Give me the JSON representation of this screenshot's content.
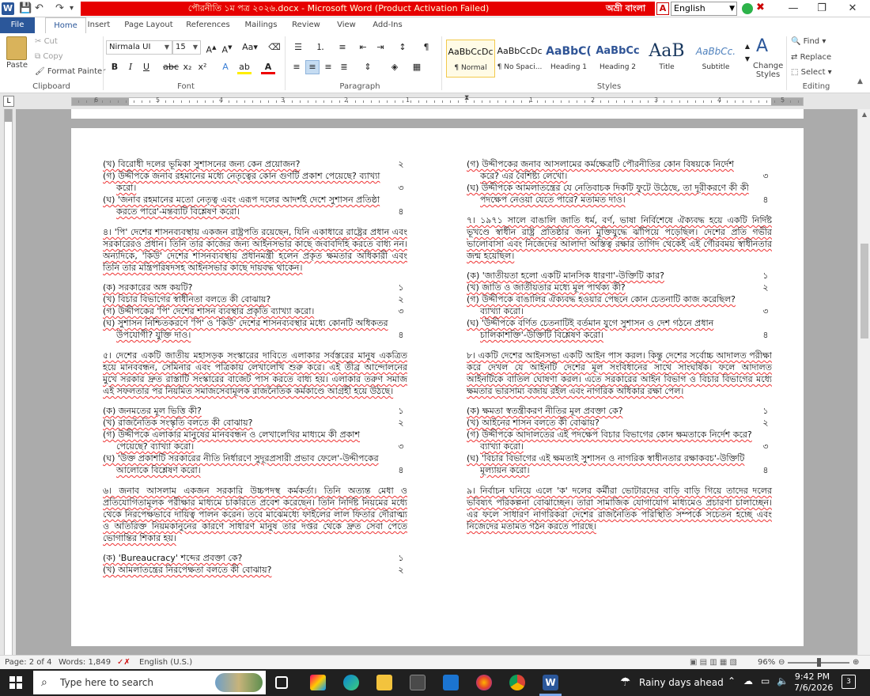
{
  "titlebar": {
    "document_title": "পৌরনীতি ১ম পত্র ২০২৬.docx - Microsoft Word (Product Activation Failed)",
    "ime_label": "অভ্রী বাংলা",
    "language_letter": "A",
    "language": "English",
    "window_buttons": [
      "—",
      "❐",
      "✕"
    ]
  },
  "tabs": [
    "File",
    "Home",
    "Insert",
    "Page Layout",
    "References",
    "Mailings",
    "Review",
    "View",
    "Add-Ins"
  ],
  "ribbon": {
    "clipboard": {
      "paste": "Paste",
      "cut": "Cut",
      "copy": "Copy",
      "format_painter": "Format Painter",
      "group": "Clipboard"
    },
    "font": {
      "name": "Nirmala UI",
      "size": "15",
      "group": "Font"
    },
    "paragraph": {
      "group": "Paragraph"
    },
    "styles": {
      "group": "Styles",
      "items": [
        {
          "sample": "AaBbCcDc",
          "label": "¶ Normal"
        },
        {
          "sample": "AaBbCcDc",
          "label": "¶ No Spaci..."
        },
        {
          "sample": "AaBbC(",
          "label": "Heading 1"
        },
        {
          "sample": "AaBbCc",
          "label": "Heading 2"
        },
        {
          "sample": "AaB",
          "label": "Title"
        },
        {
          "sample": "AaBbCc.",
          "label": "Subtitle"
        }
      ],
      "change_styles": "Change Styles"
    },
    "editing": {
      "find": "Find",
      "replace": "Replace",
      "select": "Select",
      "group": "Editing"
    }
  },
  "ruler": {
    "corner": "L",
    "numbers": [
      "6",
      "5",
      "4",
      "3",
      "2",
      "1",
      "1",
      "2",
      "3",
      "4",
      "5"
    ]
  },
  "document": {
    "left": [
      {
        "type": "questions",
        "items": [
          {
            "t": "(খ) বিরোধী দলের ভূমিকা সুশাসনের জন্য কেন প্রয়োজন?",
            "m": "২"
          },
          {
            "t": "(গ) উদ্দীপকে জনাব রহমানের মধ্যে নেতৃত্বের কোন গুণটি প্রকাশ পেয়েছে? ব্যাখ্যা করো।",
            "m": "৩"
          },
          {
            "t": "(ঘ) 'জনাব রহমানের মতো নেতৃত্ব এবং এরূপ দলের আদর্শই দেশে সুশাসন প্রতিষ্ঠা করতে পারে'-মন্তব্যটি বিশ্লেষণ করো।",
            "m": "৪"
          }
        ]
      },
      {
        "type": "para",
        "t": "৪। 'পি' দেশের শাসনব্যবস্থায় একজন রাষ্ট্রপতি রয়েছেন, যিনি একাধারে রাষ্ট্রের প্রধান এবং সরকারেরও প্রধান। তিনি তার কাজের জন্য আইনসভার কাছে জবাবদিহি করতে বাধ্য নন। অন্যদিকে, 'কিউ' দেশের শাসনব্যবস্থায় প্রধানমন্ত্রী হলেন প্রকৃত ক্ষমতার অধিকারী এবং তিনি তার মন্ত্রিপরিষদসহ আইনসভার কাছে দায়বদ্ধ থাকেন।"
      },
      {
        "type": "questions",
        "items": [
          {
            "t": "(ক) সরকারের অঙ্গ কয়টি?",
            "m": "১"
          },
          {
            "t": "(খ) বিচার বিভাগের স্বাধীনতা বলতে কী বোঝায়?",
            "m": "২"
          },
          {
            "t": "(গ) উদ্দীপকের 'পি' দেশের শাসন ব্যবস্থার প্রকৃতি ব্যাখ্যা করো।",
            "m": "৩"
          },
          {
            "t": "(ঘ) সুশাসন নিশ্চিতকরণে 'পি' ও 'কিউ' দেশের শাসনব্যবস্থার মধ্যে কোনটি অধিকতর উপযোগী? যুক্তি দাও।",
            "m": "৪"
          }
        ]
      },
      {
        "type": "para",
        "t": "৫। দেশের একটি জাতীয় মহাসড়ক সংস্কারের দাবিতে এলাকার সর্বস্তরের মানুষ একত্রিত হয়ে মানববন্ধন, সেমিনার এবং পত্রিকায় লেখালেখি শুরু করে। এই তীব্র আন্দোলনের মুখে সরকার দ্রুত রাস্তাটি সংস্কারের বাজেট পাস করতে বাধ্য হয়। এলাকার তরুণ সমাজ এই সফলতার পর নিয়মিত সমাজসেবামূলক রাজনৈতিক কর্মকাণ্ডে আগ্রহী হয়ে উঠছে।"
      },
      {
        "type": "questions",
        "items": [
          {
            "t": "(ক) জনমতের মূল ভিত্তি কী?",
            "m": "১"
          },
          {
            "t": "(খ) রাজনৈতিক সংস্কৃতি বলতে কী বোঝায়?",
            "m": "২"
          },
          {
            "t": "(গ) উদ্দীপকে এলাকার মানুষের মানববন্ধন ও লেখালেখির মাধ্যমে কী প্রকাশ পেয়েছে? ব্যাখ্যা করো।",
            "m": "৩"
          },
          {
            "t": "(ঘ) 'উক্ত প্রকাশটি সরকারের নীতি নির্ধারণে সুদূরপ্রসারী প্রভাব ফেলে'-উদ্দীপকের আলোকে বিশ্লেষণ করো।",
            "m": "৪"
          }
        ]
      },
      {
        "type": "para",
        "t": "৬। জনাব আসলাম একজন সরকারি উচ্চপদস্থ কর্মকর্তা। তিনি অত্যন্ত মেধা ও প্রতিযোগিতামূলক পরীক্ষার মাধ্যমে চাকরিতে প্রবেশ করেছেন। তিনি নির্দিষ্ট নিয়মের মধ্যে থেকে নিরপেক্ষভাবে দায়িত্ব পালন করেন। তবে মাঝেমধ্যে ফাইলের লাল ফিতার দৌরাত্ম্য ও অতিরিক্ত নিয়মকানুনের কারণে সাধারণ মানুষ তার দপ্তর থেকে দ্রুত সেবা পেতে ভোগান্তির শিকার হয়।"
      },
      {
        "type": "questions",
        "items": [
          {
            "t": "(ক) 'Bureaucracy' শব্দের প্রবক্তা কে?",
            "m": "১"
          },
          {
            "t": "(খ) আমলাতন্ত্রের নিরপেক্ষতা বলতে কী বোঝায়?",
            "m": "২"
          }
        ]
      }
    ],
    "right": [
      {
        "type": "questions",
        "items": [
          {
            "t": "(গ) উদ্দীপকের জনাব আসলামের কর্মক্ষেত্রটি পৌরনীতির কোন বিষয়কে নির্দেশ করে? এর বৈশিষ্ট্য লেখো।",
            "m": "৩"
          },
          {
            "t": "(ঘ) উদ্দীপকে আমলাতন্ত্রের যে নেতিবাচক দিকটি ফুটে উঠেছে, তা দূরীকরণে কী কী পদক্ষেপ নেওয়া যেতে পারে? মতামত দাও।",
            "m": "৪"
          }
        ]
      },
      {
        "type": "para",
        "t": "৭। ১৯৭১ সালে বাঙালি জাতি ধর্ম, বর্ণ, ভাষা নির্বিশেষে ঐক্যবদ্ধ হয়ে একটি নির্দিষ্ট ভূখণ্ডে স্বাধীন রাষ্ট্র প্রতিষ্ঠার জন্য মুক্তিযুদ্ধে ঝাঁপিয়ে পড়েছিল। দেশের প্রতি গভীর ভালোবাসা এবং নিজেদের আলাদা অস্তিত্ব রক্ষার তাগিদ থেকেই এই গৌরবময় স্বাধীনতার জন্ম হয়েছিল।"
      },
      {
        "type": "questions",
        "items": [
          {
            "t": "(ক) 'জাতীয়তা হলো একটি মানসিক ধারণা'-উক্তিটি কার?",
            "m": "১"
          },
          {
            "t": "(খ) জাতি ও জাতীয়তার মধ্যে মূল পার্থক্য কী?",
            "m": "২"
          },
          {
            "t": "(গ) উদ্দীপকে বাঙালির ঐক্যবদ্ধ হওয়ার পেছনে কোন চেতনাটি কাজ করেছিল? ব্যাখ্যা করো।",
            "m": "৩"
          },
          {
            "t": "(ঘ) 'উদ্দীপকে বর্ণিত চেতনাটিই বর্তমান যুগে সুশাসন ও দেশ গঠনে প্রধান চালিকাশক্তি'-উক্তিটি বিশ্লেষণ করো।",
            "m": "৪"
          }
        ]
      },
      {
        "type": "para",
        "t": "৮। একটি দেশের আইনসভা একটি আইন পাস করল। কিন্তু দেশের সর্বোচ্চ আদালত পরীক্ষা করে দেখল যে আইনটি দেশের মূল সংবিধানের সাথে সাংঘর্ষিক। ফলে আদালত আইনটিকে বাতিল ঘোষণা করল। এতে সরকারের আইন বিভাগ ও বিচার বিভাগের মধ্যে ক্ষমতার ভারসাম্য বজায় রইল এবং নাগরিক অধিকার রক্ষা পেল।"
      },
      {
        "type": "questions",
        "items": [
          {
            "t": "(ক) ক্ষমতা স্বতন্ত্রীকরণ নীতির মূল প্রবক্তা কে?",
            "m": "১"
          },
          {
            "t": "(খ) আইনের শাসন বলতে কী বোঝায়?",
            "m": "২"
          },
          {
            "t": "(গ) উদ্দীপকে আদালতের এই পদক্ষেপ বিচার বিভাগের কোন ক্ষমতাকে নির্দেশ করে? ব্যাখ্যা করো।",
            "m": "৩"
          },
          {
            "t": "(ঘ) 'বিচার বিভাগের এই ক্ষমতাই সুশাসন ও নাগরিক স্বাধীনতার রক্ষাকবচ'-উক্তিটি মূল্যায়ন করো।",
            "m": "৪"
          }
        ]
      },
      {
        "type": "para",
        "t": "৯। নির্বাচন ঘনিয়ে এলে 'ক' দলের কর্মীরা ভোটারদের বাড়ি বাড়ি গিয়ে তাদের দলের ভবিষ্যৎ পরিকল্পনা বোঝাচ্ছেন। তারা সামাজিক যোগাযোগ মাধ্যমেও প্রচারণা চালাচ্ছেন। এর ফলে সাধারণ নাগরিকরা দেশের রাজনৈতিক পরিস্থিতি সম্পর্কে সচেতন হচ্ছে এবং নিজেদের মতামত গঠন করতে পারছে।"
      }
    ]
  },
  "status": {
    "page": "Page: 2 of 4",
    "words": "Words: 1,849",
    "language": "English (U.S.)",
    "zoom": "96%",
    "zoom_level": 0.5
  },
  "taskbar": {
    "search_placeholder": "Type here to search",
    "weather": "Rainy days ahead",
    "time": "9:42 PM",
    "date": "7/6/2026",
    "notifications": "3"
  },
  "colors": {
    "ribbon_accent": "#2b579a",
    "title_alert": "#e60000",
    "spelling_underline": "#e33"
  }
}
